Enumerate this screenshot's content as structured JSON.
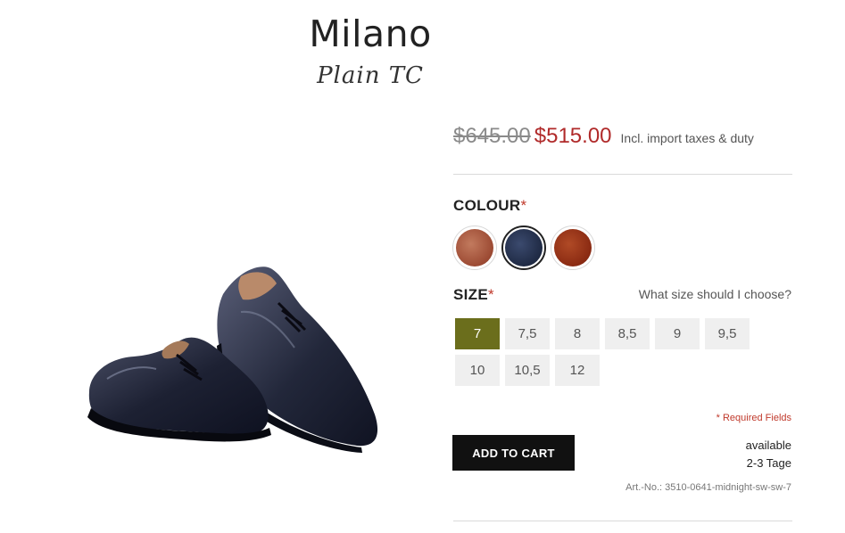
{
  "product": {
    "title": "Milano",
    "subtitle": "Plain TC"
  },
  "price": {
    "old": "$645.00",
    "new": "$515.00",
    "tax_note": "Incl. import taxes & duty"
  },
  "colour": {
    "label": "COLOUR",
    "required_mark": "*",
    "swatches": [
      {
        "name": "brown",
        "color": "#9c4a33",
        "selected": false
      },
      {
        "name": "midnight",
        "color": "#1f2a44",
        "selected": true
      },
      {
        "name": "chestnut",
        "color": "#8a2a12",
        "selected": false
      }
    ]
  },
  "size": {
    "label": "SIZE",
    "required_mark": "*",
    "help_link": "What size should I choose?",
    "options": [
      "7",
      "7,5",
      "8",
      "8,5",
      "9",
      "9,5",
      "10",
      "10,5",
      "12"
    ],
    "selected": "7"
  },
  "required_fields_note": "* Required Fields",
  "add_to_cart_label": "ADD TO CART",
  "availability": {
    "status": "available",
    "delivery": "2-3 Tage"
  },
  "article_number": "Art.-No.: 3510-0641-midnight-sw-sw-7",
  "colors": {
    "accent_price": "#b02a2a",
    "selected_size": "#6b6e1c",
    "button": "#111111"
  }
}
